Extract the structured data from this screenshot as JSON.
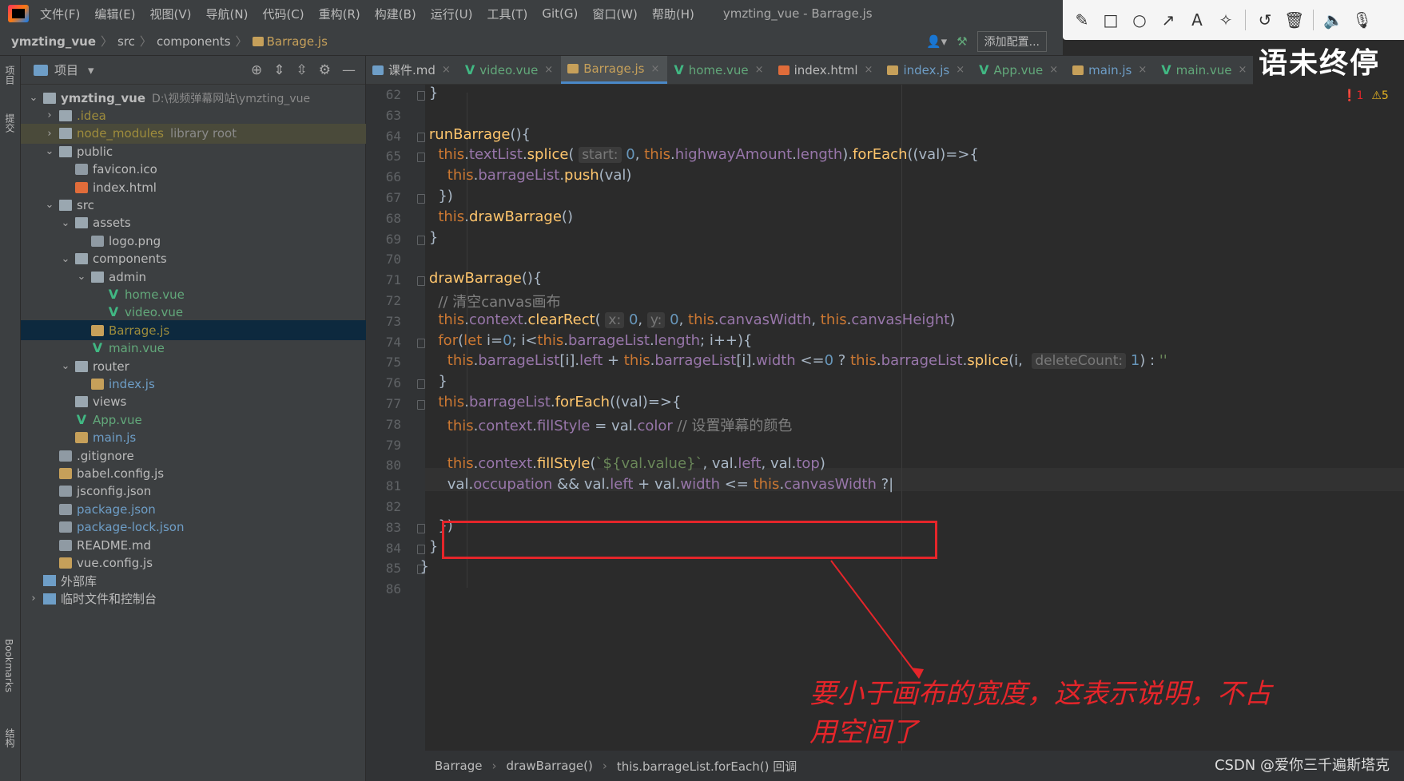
{
  "menubar": {
    "items": [
      "文件(F)",
      "编辑(E)",
      "视图(V)",
      "导航(N)",
      "代码(C)",
      "重构(R)",
      "构建(B)",
      "运行(U)",
      "工具(T)",
      "Git(G)",
      "窗口(W)",
      "帮助(H)"
    ],
    "window_title": "ymzting_vue - Barrage.js"
  },
  "navbar": {
    "project": "ymzting_vue",
    "crumbs": [
      "src",
      "components"
    ],
    "file": "Barrage.js",
    "add_config": "添加配置..."
  },
  "watermark": "语未终停",
  "left_stripe": {
    "project": "项目",
    "commit": "提交",
    "bookmarks": "Bookmarks",
    "structure": "结构"
  },
  "project_panel": {
    "title": "项目",
    "tree": [
      {
        "label": "ymzting_vue",
        "path": "D:\\视频弹幕网站\\ymzting_vue",
        "type": "folder",
        "depth": 0,
        "arrow": "⌄"
      },
      {
        "label": ".idea",
        "type": "folder",
        "depth": 1,
        "arrow": "›"
      },
      {
        "label": "node_modules",
        "extra": "library root",
        "type": "folder",
        "depth": 1,
        "arrow": "›"
      },
      {
        "label": "public",
        "type": "folder",
        "depth": 1,
        "arrow": "⌄"
      },
      {
        "label": "favicon.ico",
        "type": "file",
        "depth": 2
      },
      {
        "label": "index.html",
        "type": "html",
        "depth": 2
      },
      {
        "label": "src",
        "type": "folder",
        "depth": 1,
        "arrow": "⌄"
      },
      {
        "label": "assets",
        "type": "folder",
        "depth": 2,
        "arrow": "⌄"
      },
      {
        "label": "logo.png",
        "type": "img",
        "depth": 3
      },
      {
        "label": "components",
        "type": "folder",
        "depth": 2,
        "arrow": "⌄"
      },
      {
        "label": "admin",
        "type": "folder",
        "depth": 3,
        "arrow": "⌄"
      },
      {
        "label": "home.vue",
        "type": "vue",
        "depth": 4
      },
      {
        "label": "video.vue",
        "type": "vue",
        "depth": 4
      },
      {
        "label": "Barrage.js",
        "type": "js",
        "depth": 3
      },
      {
        "label": "main.vue",
        "type": "vue",
        "depth": 3
      },
      {
        "label": "router",
        "type": "folder",
        "depth": 2,
        "arrow": "⌄"
      },
      {
        "label": "index.js",
        "type": "js",
        "depth": 3
      },
      {
        "label": "views",
        "type": "folder",
        "depth": 2
      },
      {
        "label": "App.vue",
        "type": "vue",
        "depth": 2
      },
      {
        "label": "main.js",
        "type": "js",
        "depth": 2
      },
      {
        "label": ".gitignore",
        "type": "file",
        "depth": 1
      },
      {
        "label": "babel.config.js",
        "type": "js",
        "depth": 1
      },
      {
        "label": "jsconfig.json",
        "type": "file",
        "depth": 1
      },
      {
        "label": "package.json",
        "type": "file",
        "depth": 1
      },
      {
        "label": "package-lock.json",
        "type": "file",
        "depth": 1
      },
      {
        "label": "README.md",
        "type": "file",
        "depth": 1
      },
      {
        "label": "vue.config.js",
        "type": "js",
        "depth": 1
      },
      {
        "label": "外部库",
        "type": "lib",
        "depth": 0
      },
      {
        "label": "临时文件和控制台",
        "type": "lib",
        "depth": 0,
        "arrow": "›"
      }
    ]
  },
  "tabs": [
    {
      "label": "课件.md",
      "type": "md"
    },
    {
      "label": "video.vue",
      "type": "vue"
    },
    {
      "label": "Barrage.js",
      "type": "js",
      "active": true
    },
    {
      "label": "home.vue",
      "type": "vue"
    },
    {
      "label": "index.html",
      "type": "html"
    },
    {
      "label": "index.js",
      "type": "js"
    },
    {
      "label": "App.vue",
      "type": "vue"
    },
    {
      "label": "main.js",
      "type": "js"
    },
    {
      "label": "main.vue",
      "type": "vue"
    }
  ],
  "inspections": {
    "errors": "1",
    "warnings": "5"
  },
  "editor": {
    "line_numbers": [
      "62",
      "63",
      "64",
      "65",
      "66",
      "67",
      "68",
      "69",
      "70",
      "71",
      "72",
      "73",
      "74",
      "75",
      "76",
      "77",
      "78",
      "79",
      "80",
      "81",
      "82",
      "83",
      "84",
      "85",
      "86"
    ],
    "current_line": "81"
  },
  "annotation": "要小于画布的宽度，这表示说明，不占用空间了",
  "footer": {
    "crumbs": [
      "Barrage",
      "drawBarrage()",
      "this.barrageList.forEach() 回调"
    ]
  },
  "csdn": "CSDN @爱你三千遍斯塔克",
  "colors": {
    "accent": "#4a88c7",
    "annotation": "#e5252a",
    "keyword": "#cc7832",
    "function": "#ffc66d",
    "property": "#9876aa",
    "number": "#6897bb"
  }
}
